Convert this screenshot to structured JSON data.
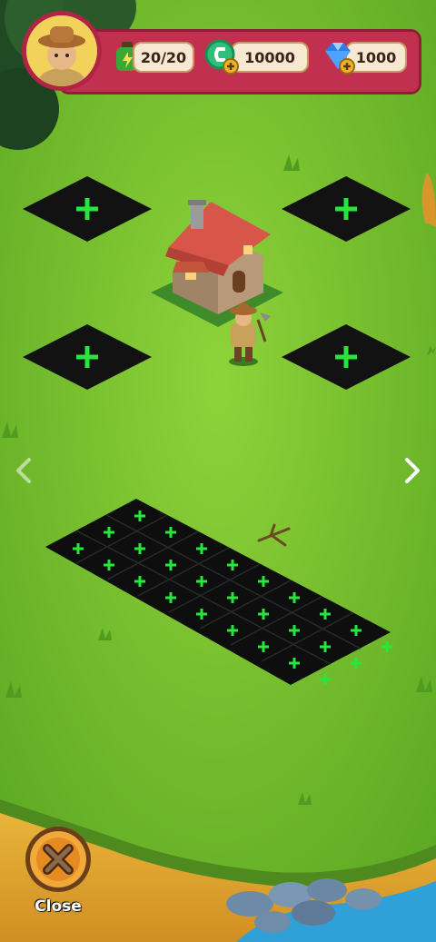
{
  "hud": {
    "energy": "20/20",
    "coins": "10000",
    "gems": "1000"
  },
  "controls": {
    "close_label": "Close"
  },
  "icons": {
    "prev": "chevron-left-icon",
    "next": "chevron-right-icon",
    "close": "close-x-icon",
    "plus": "plus-icon"
  },
  "colors": {
    "hud_red": "#c2304f",
    "plus_green": "#27e63e",
    "plot_dark": "#121212",
    "grass": "#7cc62a"
  }
}
